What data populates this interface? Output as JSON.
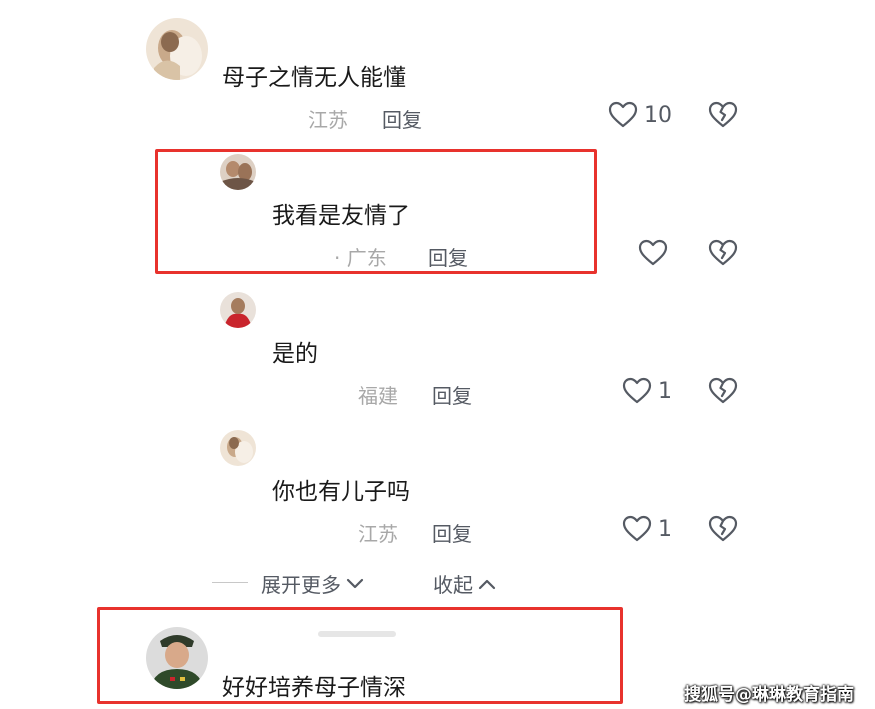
{
  "comments": [
    {
      "text": "母子之情无人能懂",
      "location": "江苏",
      "reply": "回复",
      "likes": "10"
    },
    {
      "text": "我看是友情了",
      "location": "· 广东",
      "reply": "回复",
      "likes": ""
    },
    {
      "text": "是的",
      "location": "福建",
      "reply": "回复",
      "likes": "1"
    },
    {
      "text": "你也有儿子吗",
      "location": "江苏",
      "reply": "回复",
      "likes": "1"
    },
    {
      "text": "好好培养母子情深"
    }
  ],
  "controls": {
    "expand_more": "展开更多",
    "collapse": "收起"
  },
  "watermark": "搜狐号@琳琳教育指南",
  "colors": {
    "highlight": "#e8322d",
    "meta": "#a8a8a8",
    "action": "#555a63"
  }
}
